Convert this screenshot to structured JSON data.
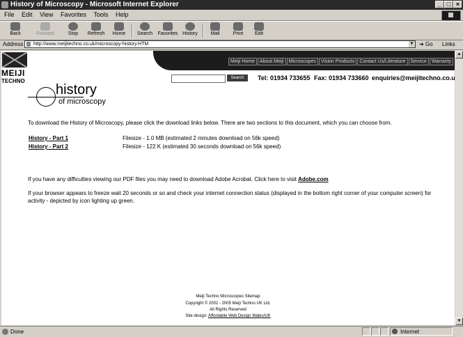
{
  "window": {
    "title": "History of Microscopy - Microsoft Internet Explorer"
  },
  "menubar": {
    "items": [
      "File",
      "Edit",
      "View",
      "Favorites",
      "Tools",
      "Help"
    ]
  },
  "toolbar": {
    "back": "Back",
    "forward": "Forward",
    "stop": "Stop",
    "refresh": "Refresh",
    "home": "Home",
    "search": "Search",
    "favorites": "Favorites",
    "history": "History",
    "mail": "Mail",
    "print": "Print",
    "edit": "Edit"
  },
  "addressbar": {
    "label": "Address",
    "url": "http://www.meijitechno.co.uk/microscopy-history.HTM",
    "go": "Go",
    "links": "Links"
  },
  "page": {
    "logo": {
      "meiji": "MEIJI",
      "techno": "TECHNO"
    },
    "nav": [
      "Meiji Home",
      "About Meiji",
      "Microscopes",
      "Vision Products",
      "Contact Us/Literature",
      "Service",
      "Warranty"
    ],
    "search_button": "Search",
    "tel": "Tel: 01934 733655",
    "fax": "Fax: 01934 733660",
    "email": "enquiries@meijitechno.co.uk",
    "heading_main": "history",
    "heading_sub": "of microscopy",
    "intro": "To download the History of Microscopy, please click the download links below. There are two sections to this document, which you can choose from.",
    "downloads": [
      {
        "label": "History - Part 1",
        "info": "Filesize - 1.0 MB (estimated 2 minutes download on 56k speed)"
      },
      {
        "label": "History - Part 2",
        "info": "Filesize - 122 K (estimated 30 seconds download on 56k speed)"
      }
    ],
    "acrobat_text": "If you have any difficulties viewing our PDF files you may need to download Adobe Acrobat. Click here to visit",
    "acrobat_link": "Adobe.com",
    "freeze_line1": "If your browser appears to freeze wait 20 seconds or so and check your internet connection status (displayed in the bottom right corner of your computer screen) for",
    "freeze_line2": "activity - depicted by icon lighting up green.",
    "footer": {
      "sitemap": "Meiji Techno Microscopes Sitemap",
      "copyright": "Copyright © 2002 - 2005 Meiji Techno UK Ltd.",
      "rights": "All Rights Reserved",
      "design_prefix": "Site design:",
      "design_link": "Affordable Web Design Wales/UK"
    }
  },
  "statusbar": {
    "text": "Done",
    "zone": "Internet"
  }
}
